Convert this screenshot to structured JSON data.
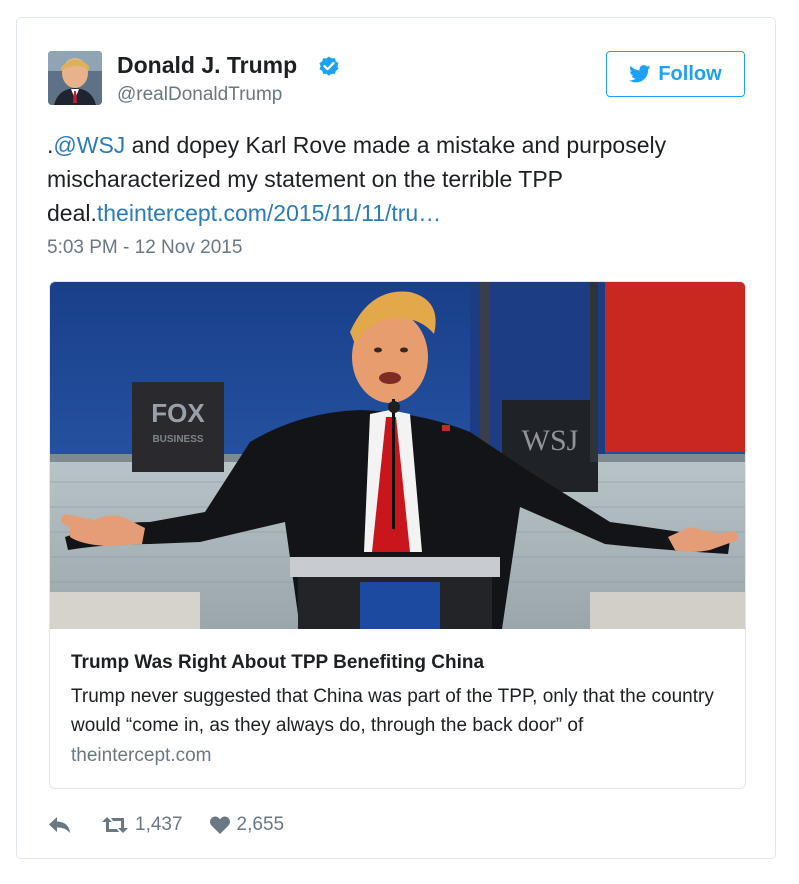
{
  "tweet": {
    "display_name": "Donald J. Trump",
    "handle": "@realDonaldTrump",
    "verified": true,
    "follow_label": "Follow",
    "text_parts": {
      "prefix": ".",
      "mention": "@WSJ",
      "body": " and dopey Karl Rove made a mistake and purposely mischaracterized my statement on the terrible TPP deal.",
      "link": "theintercept.com/2015/11/11/tru…"
    },
    "timestamp": "5:03 PM - 12 Nov 2015"
  },
  "card": {
    "title": "Trump Was Right About TPP Benefiting China",
    "description": "Trump never suggested that China was part of the TPP, only that the country would “come in, as they always do, through the back door” of",
    "domain": "theintercept.com",
    "image_signs": {
      "left": "FOX",
      "left_sub": "BUSINESS",
      "right": "WSJ"
    }
  },
  "actions": {
    "retweets": "1,437",
    "likes": "2,655"
  },
  "colors": {
    "accent": "#1da1f2",
    "link": "#2b7bb9",
    "muted": "#697882",
    "text": "#1c2022",
    "border": "#e1e8ed"
  },
  "icons": {
    "verified": "verified-badge-icon",
    "follow": "twitter-bird-icon",
    "reply": "reply-icon",
    "retweet": "retweet-icon",
    "like": "heart-icon"
  }
}
